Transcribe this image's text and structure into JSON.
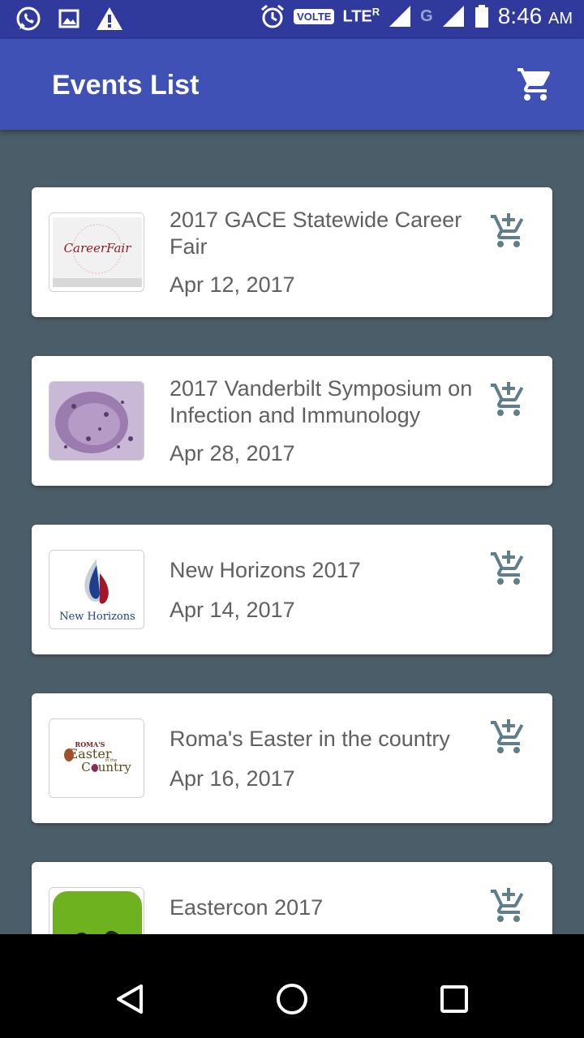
{
  "status_bar": {
    "volte": "VOLTE",
    "lte": "LTE",
    "roaming": "R",
    "network_g": "G",
    "time": "8:46",
    "ampm": "AM"
  },
  "app_bar": {
    "title": "Events List",
    "cart_icon": "shopping-cart-icon"
  },
  "events": [
    {
      "title": "2017 GACE Statewide Career Fair",
      "date": "Apr 12, 2017",
      "thumb_text": "CareerFair"
    },
    {
      "title": "2017 Vanderbilt Symposium on Infection and Immunology",
      "date": "Apr 28, 2017"
    },
    {
      "title": "New Horizons 2017",
      "date": "Apr 14, 2017",
      "thumb_text": "New Horizons"
    },
    {
      "title": "Roma's Easter in the country",
      "date": "Apr 16, 2017",
      "thumb_text_1": "ROMA'S",
      "thumb_text_2": "Easter",
      "thumb_text_3": "in the",
      "thumb_text_4": "Country"
    },
    {
      "title": "Eastercon 2017",
      "date": ""
    }
  ],
  "colors": {
    "status_bar": "#2f3a9c",
    "app_bar": "#3f51b5",
    "background": "#4b5d68",
    "icon": "#607d8b"
  }
}
